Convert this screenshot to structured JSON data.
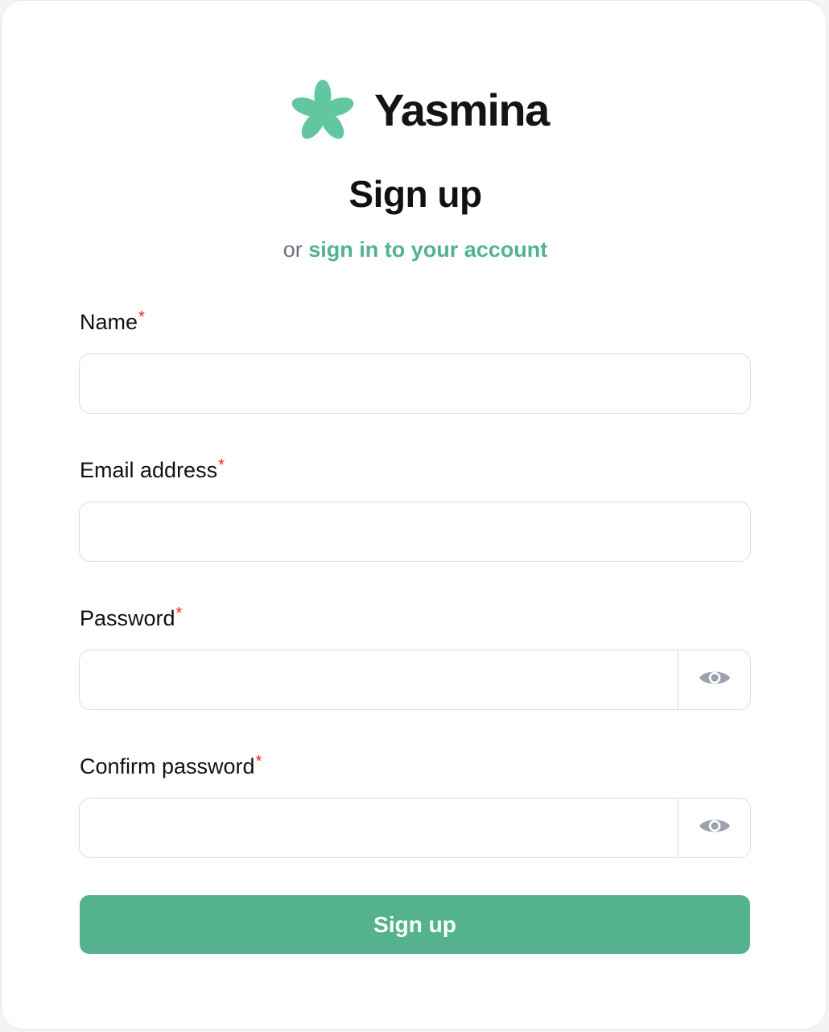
{
  "brand": {
    "name": "Yasmina",
    "logo_icon": "jasmine-flower-icon",
    "logo_color": "#62c7a0"
  },
  "page": {
    "title": "Sign up",
    "subtitle_prefix": "or",
    "signin_link": "sign in to your account"
  },
  "form": {
    "required_marker": "*",
    "name": {
      "label": "Name",
      "value": "",
      "placeholder": ""
    },
    "email": {
      "label": "Email address",
      "value": "",
      "placeholder": ""
    },
    "password": {
      "label": "Password",
      "value": "",
      "placeholder": "",
      "toggle_icon": "eye-icon"
    },
    "confirm_password": {
      "label": "Confirm password",
      "value": "",
      "placeholder": "",
      "toggle_icon": "eye-icon"
    },
    "submit_label": "Sign up"
  },
  "colors": {
    "accent": "#54b28e",
    "link": "#53b28f",
    "required": "#dc2626",
    "muted": "#6b7280",
    "icon_gray": "#9ca3af"
  }
}
